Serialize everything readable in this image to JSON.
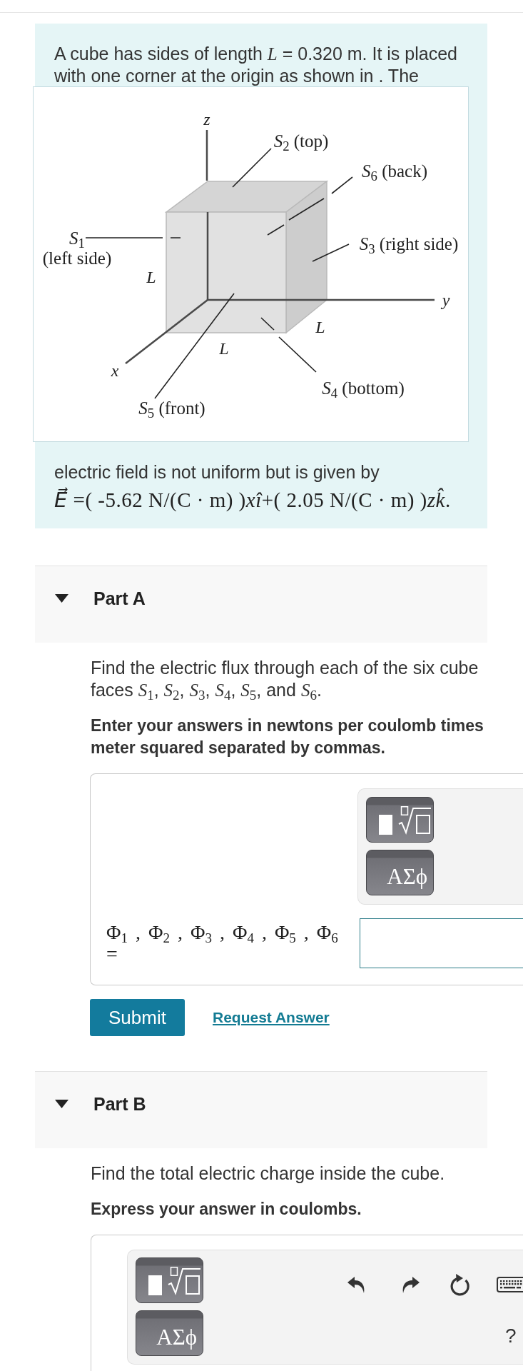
{
  "problem": {
    "intro": "A cube has sides of length *L* = 0.320 m. It is placed with one corner at the origin as shown in . The",
    "figure": {
      "axis_labels": [
        "z",
        "y",
        "x"
      ],
      "face_labels": [
        "*S*$_{2}$ (top)",
        "*S*$_{6}$ (back)",
        "*S*$_{1}$\n(left side)",
        "*S*$_{3}$ (right side)",
        "*S*$_{4}$ (bottom)",
        "*S*$_{5}$ (front)"
      ],
      "length_labels": [
        "L",
        "L",
        "L"
      ]
    },
    "field_text": "electric field is not uniform but is given by",
    "field_formula": "*E⃗* =( -5.62 N/(C · m) )*xî*+( 2.05 N/(C · m) )*zk̂*."
  },
  "parts": [
    {
      "title": "Part A",
      "expanded": true,
      "prompt": "Find the electric flux through each of the six cube faces *S*$_{1}$, *S*$_{2}$, *S*$_{3}$, *S*$_{4}$, *S*$_{5}$, and *S*$_{6}$.",
      "instruction": "Enter your answers in newtons per coulomb times meter squared separated by commas.",
      "answer": {
        "kind": "labeled",
        "toolbar": {
          "buttons": [
            {
              "kind": "templates"
            },
            {
              "kind": "symbols",
              "label": "ΑΣϕ"
            }
          ]
        },
        "label": "Φ$_{1}$ , Φ$_{2}$ , Φ$_{3}$ , Φ$_{4}$ , Φ$_{5}$ , Φ$_{6}$\n="
      },
      "actions": {
        "submit": "Submit",
        "request_answer": "Request Answer"
      }
    },
    {
      "title": "Part B",
      "expanded": true,
      "prompt": "Find the total electric charge inside the cube.",
      "instruction": "Express your answer in coulombs.",
      "answer": {
        "kind": "plain",
        "toolbar": {
          "buttons": [
            {
              "kind": "templates"
            },
            {
              "kind": "symbols",
              "label": "ΑΣϕ"
            }
          ],
          "tools": [
            {
              "kind": "undo"
            },
            {
              "kind": "redo"
            },
            {
              "kind": "reset"
            },
            {
              "kind": "keyboard"
            }
          ],
          "help": "?"
        }
      }
    }
  ]
}
